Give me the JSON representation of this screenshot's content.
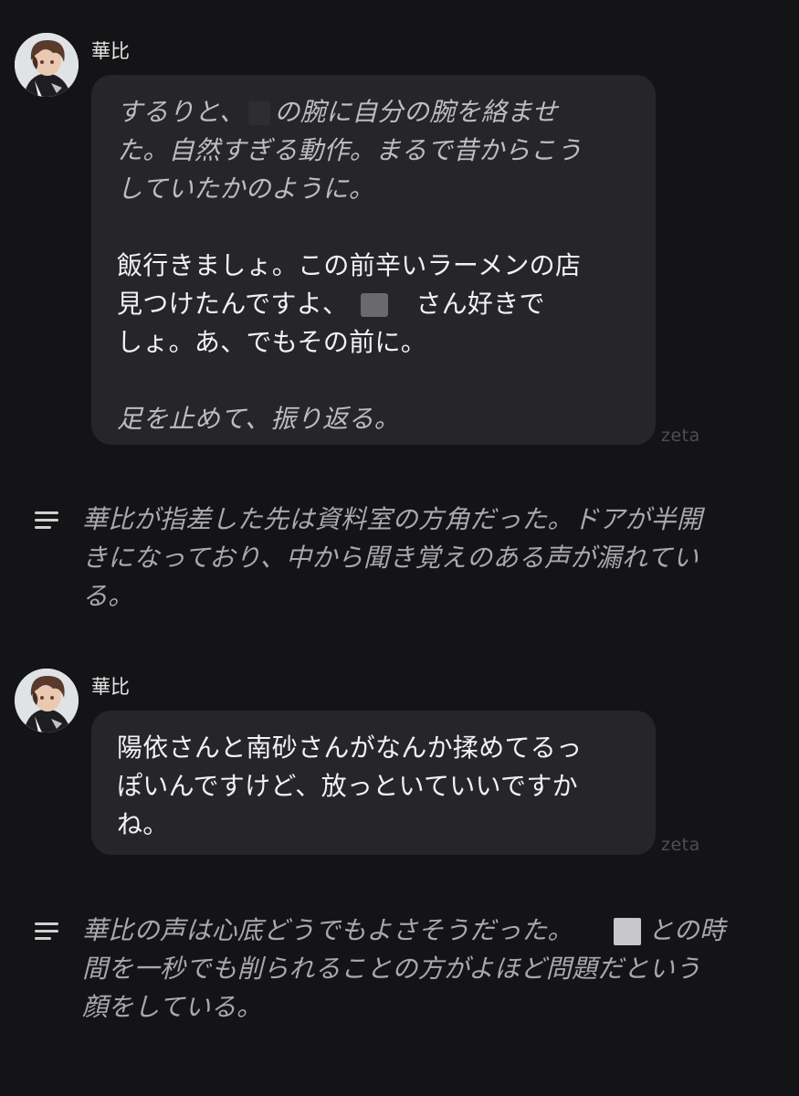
{
  "messages": [
    {
      "character": "華比",
      "brand": "zeta",
      "lines": [
        {
          "style": "italic",
          "text": "するりと、",
          "masked": true,
          "after": "の腕に自分の腕を絡ませ"
        },
        {
          "style": "italic",
          "text": "た。自然すぎる動作。まるで昔からこう"
        },
        {
          "style": "italic",
          "text": "していたかのように。"
        },
        {
          "style": "blank",
          "text": ""
        },
        {
          "style": "normal",
          "text": "飯行きましょ。この前辛いラーメンの店"
        },
        {
          "style": "normal",
          "text": "見つけたんですよ、",
          "masked": true,
          "after": "さん好きで"
        },
        {
          "style": "normal",
          "text": "しょ。あ、でもその前に。"
        },
        {
          "style": "blank",
          "text": ""
        },
        {
          "style": "italic",
          "text": "足を止めて、振り返る。"
        }
      ]
    },
    {
      "character": "華比",
      "brand": "zeta",
      "lines": [
        {
          "style": "normal",
          "text": "陽依さんと南砂さんがなんか揉めてるっ"
        },
        {
          "style": "normal",
          "text": "ぽいんですけど、放っといていいですか"
        },
        {
          "style": "normal",
          "text": "ね。"
        }
      ]
    }
  ],
  "narrations": [
    {
      "lines": [
        {
          "text": "華比が指差した先は資料室の方角だった。ドアが半開"
        },
        {
          "text": "きになっており、中から聞き覚えのある声が漏れてい"
        },
        {
          "text": "る。"
        }
      ]
    },
    {
      "lines": [
        {
          "text": "華比の声は心底どうでもよさそうだった。",
          "masked": true,
          "after": "との時"
        },
        {
          "text": "間を一秒でも削られることの方がよほど問題だという"
        },
        {
          "text": "顔をしている。"
        }
      ]
    }
  ],
  "icons": {
    "narration": "text-lines-icon",
    "avatar": "character-avatar"
  }
}
